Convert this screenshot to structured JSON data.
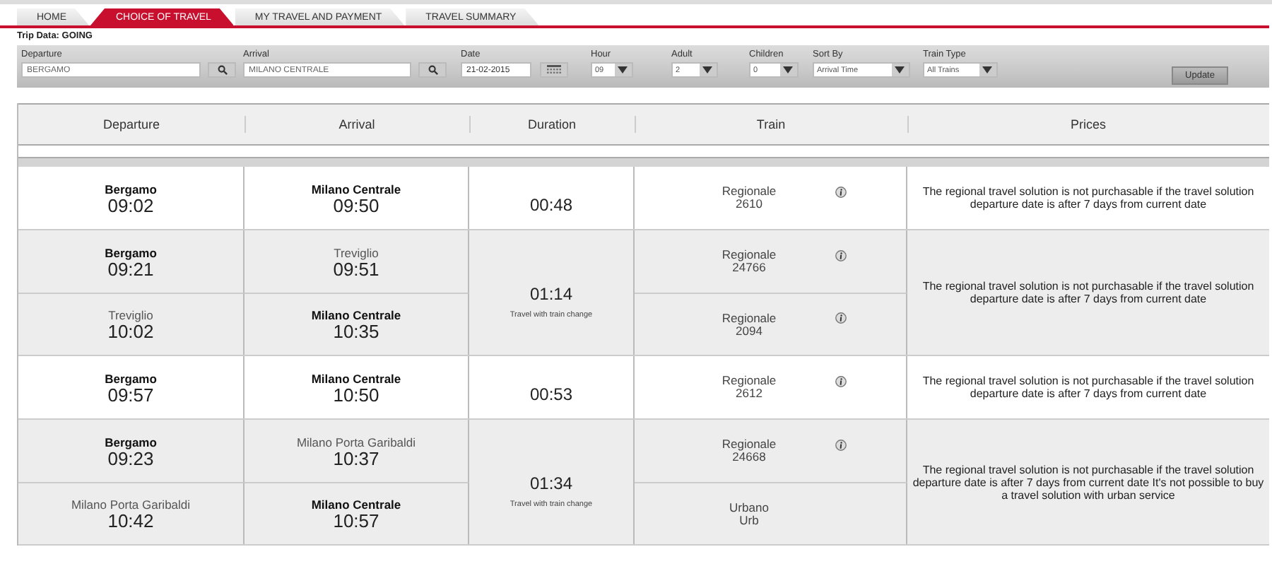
{
  "tabs": [
    {
      "label": "HOME",
      "selected": false
    },
    {
      "label": "CHOICE OF TRAVEL",
      "selected": true
    },
    {
      "label": "MY TRAVEL AND PAYMENT",
      "selected": false
    },
    {
      "label": "TRAVEL SUMMARY",
      "selected": false
    }
  ],
  "trip_data": "Trip Data:  GOING",
  "search": {
    "fields": [
      {
        "kind": "text",
        "label": "Departure",
        "value": "BERGAMO"
      },
      {
        "kind": "text",
        "label": "Arrival",
        "value": "MILANO CENTRALE"
      },
      {
        "kind": "date",
        "label": "Date",
        "value": "21-02-2015"
      },
      {
        "kind": "select",
        "label": "Hour",
        "value": "09"
      },
      {
        "kind": "select",
        "label": "Adult",
        "value": "2"
      },
      {
        "kind": "select",
        "label": "Children",
        "value": "0"
      },
      {
        "kind": "select",
        "label": "Sort By",
        "value": "Arrival Time"
      },
      {
        "kind": "select",
        "label": "Train Type",
        "value": "All Trains"
      }
    ],
    "button": "Update"
  },
  "columns": [
    "Departure",
    "Arrival",
    "Duration",
    "Train",
    "Prices"
  ],
  "solutions": [
    {
      "duration": "00:48",
      "legs": [
        {
          "from": "Bergamo",
          "from_bold": true,
          "dep": "09:02",
          "to": "Milano Centrale",
          "to_bold": true,
          "arr": "09:50",
          "train": "Regionale",
          "number": "2610",
          "info": true
        }
      ],
      "price": "The regional travel solution is not purchasable if the travel solution departure date is after 7 days from current date"
    },
    {
      "duration": "01:14",
      "note": "Travel with train change",
      "legs": [
        {
          "from": "Bergamo",
          "from_bold": true,
          "dep": "09:21",
          "to": "Treviglio",
          "to_bold": false,
          "arr": "09:51",
          "train": "Regionale",
          "number": "24766",
          "info": true
        },
        {
          "from": "Treviglio",
          "from_bold": false,
          "dep": "10:02",
          "to": "Milano Centrale",
          "to_bold": true,
          "arr": "10:35",
          "train": "Regionale",
          "number": "2094",
          "info": true
        }
      ],
      "price": "The regional travel solution is not purchasable if the travel solution departure date is after 7 days from current date"
    },
    {
      "duration": "00:53",
      "legs": [
        {
          "from": "Bergamo",
          "from_bold": true,
          "dep": "09:57",
          "to": "Milano Centrale",
          "to_bold": true,
          "arr": "10:50",
          "train": "Regionale",
          "number": "2612",
          "info": true
        }
      ],
      "price": "The regional travel solution is not purchasable if the travel solution departure date is after 7 days from current date"
    },
    {
      "duration": "01:34",
      "note": "Travel with train change",
      "legs": [
        {
          "from": "Bergamo",
          "from_bold": true,
          "dep": "09:23",
          "to": "Milano Porta Garibaldi",
          "to_bold": false,
          "arr": "10:37",
          "train": "Regionale",
          "number": "24668",
          "info": true
        },
        {
          "from": "Milano Porta Garibaldi",
          "from_bold": false,
          "dep": "10:42",
          "to": "Milano Centrale",
          "to_bold": true,
          "arr": "10:57",
          "train": "Urbano",
          "number": "Urb",
          "info": false
        }
      ],
      "price": "The regional travel solution is not purchasable if the travel solution departure date is after 7 days from current date It's not possible to buy a travel solution with urban service"
    }
  ]
}
